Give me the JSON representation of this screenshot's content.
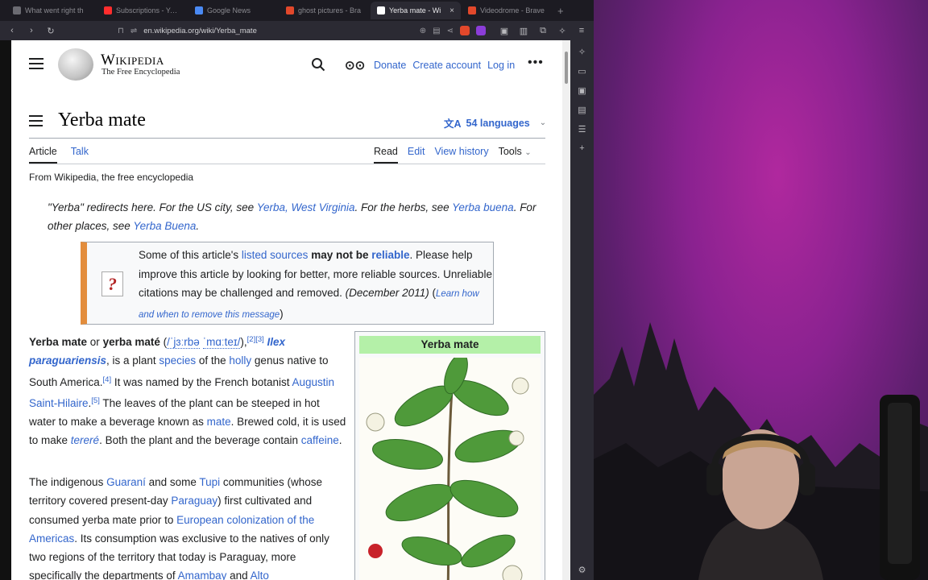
{
  "browser": {
    "tabs": [
      {
        "label": "What went right th",
        "fav": "#6b6b72",
        "active": false
      },
      {
        "label": "Subscriptions - YouT",
        "fav": "#ff2d2d",
        "active": false
      },
      {
        "label": "Google News",
        "fav": "#4a8af4",
        "active": false
      },
      {
        "label": "ghost pictures - Bra",
        "fav": "#e2482b",
        "active": false
      },
      {
        "label": "Yerba mate - Wi",
        "fav": "#ffffff",
        "active": true
      },
      {
        "label": "Videodrome - Brave",
        "fav": "#e2482b",
        "active": false
      }
    ],
    "tab_close": "×",
    "new_tab": "+",
    "url": "en.wikipedia.org/wiki/Yerba_mate"
  },
  "wiki": {
    "logo_title": "Wikipedia",
    "logo_subtitle": "The Free Encyclopedia",
    "header_links": {
      "donate": "Donate",
      "create_account": "Create account",
      "login": "Log in"
    },
    "more": "•••",
    "title": "Yerba mate",
    "languages": "54 languages",
    "tabs_left": {
      "article": "Article",
      "talk": "Talk"
    },
    "tabs_right": {
      "read": "Read",
      "edit": "Edit",
      "history": "View history",
      "tools": "Tools"
    },
    "from": "From Wikipedia, the free encyclopedia",
    "hatnote": {
      "t1": "\"Yerba\" redirects here. For the US city, see ",
      "l1": "Yerba, West Virginia",
      "t2": ". For the herbs, see ",
      "l2": "Yerba buena",
      "t3": ". For other places, see ",
      "l3": "Yerba Buena",
      "t4": "."
    },
    "ambox": {
      "icon": "?",
      "t1": "Some of this article's ",
      "l1": "listed sources",
      "t2": "may not be",
      "l2": "reliable",
      "t3": ". Please help improve this article by looking for better, more reliable sources. Unreliable citations may be challenged and removed. ",
      "date": "(December 2011)",
      "t4": " (",
      "l3": "Learn how and when to remove this message",
      "t5": ")"
    },
    "para1": {
      "b1": "Yerba mate",
      "t1": " or ",
      "b2": "yerba maté",
      "t2": " (",
      "ipa1": "/ˈjɜːrbə",
      "ipa2": "ˈmɑːteɪ/",
      "t3": "),",
      "s1": "[2]",
      "s2": "[3]",
      "t4": " ",
      "sci": "Ilex paraguariensis",
      "t5": ", is a plant ",
      "l1": "species",
      "t6": " of the ",
      "l2": "holly",
      "t7": " genus native to South America.",
      "s3": "[4]",
      "t8": " It was named by the French botanist ",
      "l3": "Augustin Saint-Hilaire",
      "t9": ".",
      "s4": "[5]",
      "t10": " The leaves of the plant can be steeped in hot water to make a beverage known as ",
      "l4": "mate",
      "t11": ". Brewed cold, it is used to make ",
      "l5": "tereré",
      "t12": ". Both the plant and the beverage contain ",
      "l6": "caffeine",
      "t13": "."
    },
    "para2": {
      "t1": "The indigenous ",
      "l1": "Guaraní",
      "t2": " and some ",
      "l2": "Tupi",
      "t3": " communities (whose territory covered present-day ",
      "l3": "Paraguay",
      "t4": ") first cultivated and consumed yerba mate prior to ",
      "l4": "European colonization of the Americas",
      "t5": ". Its consumption was exclusive to the natives of only two regions of the territory that today is Paraguay, more specifically the departments of ",
      "l5": "Amambay",
      "t6": " and ",
      "l6": "Alto"
    },
    "infobox_title": "Yerba mate"
  },
  "colors": {
    "link": "#3366cc",
    "infobox_header": "#b4f0a8",
    "ambox_stripe": "#e38d3c"
  }
}
